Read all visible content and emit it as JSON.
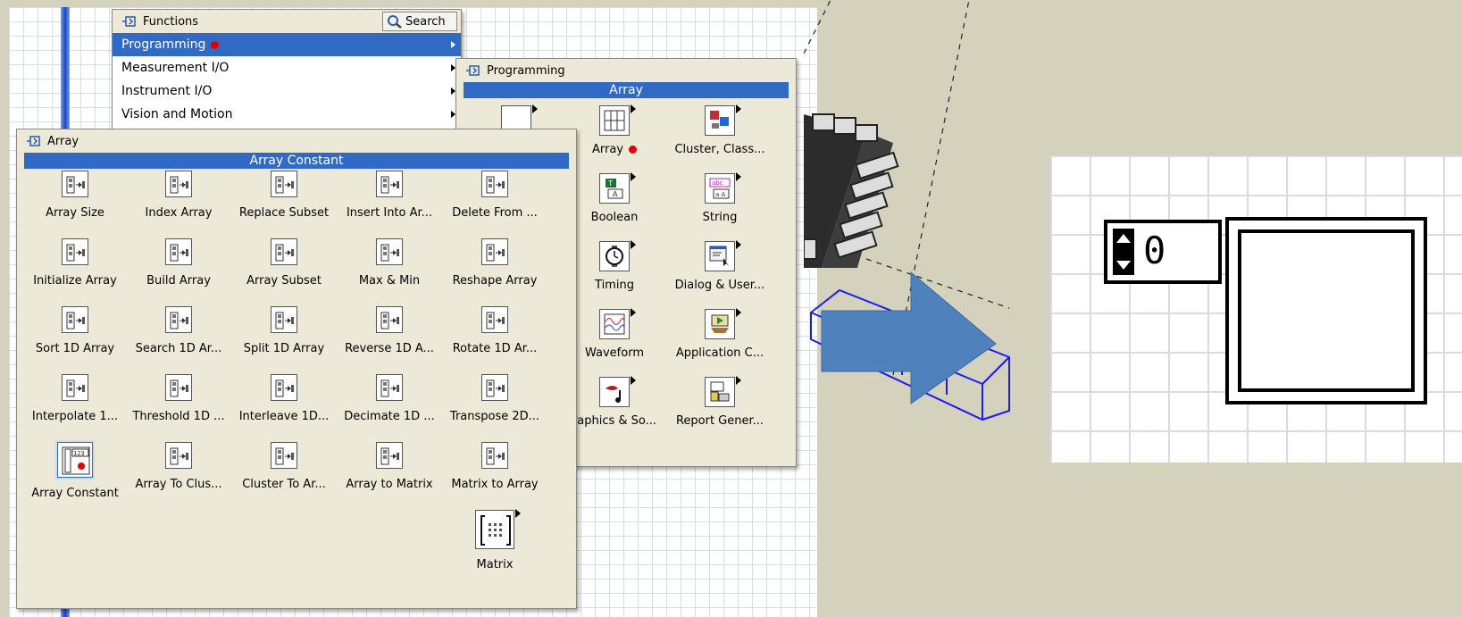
{
  "functions_menu": {
    "title": "Functions",
    "search_label": "Search",
    "items": [
      {
        "label": "Programming",
        "selected": true,
        "has_dot": true
      },
      {
        "label": "Measurement I/O",
        "selected": false
      },
      {
        "label": "Instrument I/O",
        "selected": false
      },
      {
        "label": "Vision and Motion",
        "selected": false
      }
    ]
  },
  "programming_palette": {
    "title": "Programming",
    "band": "Array",
    "items": [
      {
        "label": "",
        "icon": "structures-icon"
      },
      {
        "label": "Array",
        "icon": "array-icon",
        "has_dot": true
      },
      {
        "label": "Cluster, Class...",
        "icon": "cluster-icon"
      },
      {
        "label": "",
        "icon": "numeric-icon"
      },
      {
        "label": "Boolean",
        "icon": "boolean-icon"
      },
      {
        "label": "String",
        "icon": "string-icon"
      },
      {
        "label": "",
        "icon": "comparison-icon"
      },
      {
        "label": "Timing",
        "icon": "timing-icon"
      },
      {
        "label": "Dialog & User...",
        "icon": "dialog-icon"
      },
      {
        "label": "",
        "icon": "file-io-icon"
      },
      {
        "label": "Waveform",
        "icon": "waveform-icon"
      },
      {
        "label": "Application C...",
        "icon": "application-control-icon"
      },
      {
        "label": "Graphics & So...",
        "icon": "graphics-sound-icon"
      },
      {
        "label": "Report Gener...",
        "icon": "report-generation-icon"
      }
    ],
    "graphics_label": "raphics & So..."
  },
  "array_palette": {
    "title": "Array",
    "band": "Array Constant",
    "items": [
      "Array Size",
      "Index Array",
      "Replace Subset",
      "Insert Into Ar...",
      "Delete From ...",
      "Initialize Array",
      "Build Array",
      "Array Subset",
      "Max & Min",
      "Reshape Array",
      "Sort 1D Array",
      "Search 1D Ar...",
      "Split 1D Array",
      "Reverse 1D A...",
      "Rotate 1D Ar...",
      "Interpolate 1...",
      "Threshold 1D ...",
      "Interleave 1D...",
      "Decimate 1D ...",
      "Transpose 2D...",
      "Array Constant",
      "Array To Clus...",
      "Cluster To Ar...",
      "Array to Matrix",
      "Matrix to Array",
      "Matrix"
    ],
    "selected": "Array Constant",
    "array_icon_text": "123"
  },
  "array_constant_zoom": {
    "index_value": "0"
  },
  "colors": {
    "selection": "#316ac5",
    "background": "#d4d1bd",
    "arrow": "#4f81bd",
    "palette": "#ece9d8"
  }
}
